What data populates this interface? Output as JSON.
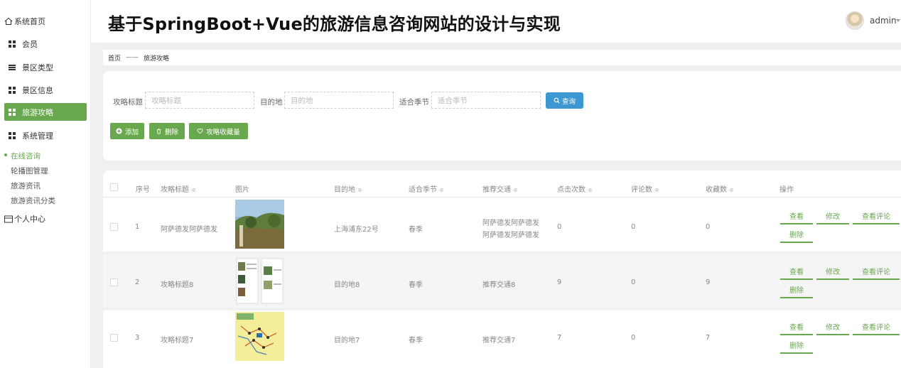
{
  "sidebar": {
    "home": "系统首页",
    "items": [
      {
        "label": "会员",
        "icon": "grid-icon"
      },
      {
        "label": "景区类型",
        "icon": "list-icon"
      },
      {
        "label": "景区信息",
        "icon": "grid-icon"
      },
      {
        "label": "旅游攻略",
        "icon": "grid-icon",
        "active": true
      },
      {
        "label": "系统管理",
        "icon": "grid-icon"
      }
    ],
    "sub_items": [
      "在线咨询",
      "轮播图管理",
      "旅游资讯",
      "旅游资讯分类"
    ],
    "personal": "个人中心"
  },
  "header": {
    "title": "基于SpringBoot+Vue的旅游信息咨询网站的设计与实现",
    "user": "admin"
  },
  "breadcrumb": {
    "home": "首页",
    "separator": "——",
    "current": "旅游攻略"
  },
  "search": {
    "fields": [
      {
        "label": "攻略标题",
        "placeholder": "攻略标题"
      },
      {
        "label": "目的地",
        "placeholder": "目的地"
      },
      {
        "label": "适合季节",
        "placeholder": "适合季节"
      }
    ],
    "query_button": "查询"
  },
  "toolbar": {
    "add": "添加",
    "delete": "删除",
    "favorites": "攻略收藏量"
  },
  "table": {
    "headers": [
      "序号",
      "攻略标题",
      "图片",
      "目的地",
      "适合季节",
      "推荐交通",
      "点击次数",
      "评论数",
      "收藏数",
      "操作"
    ],
    "rows": [
      {
        "index": "1",
        "title": "阿萨德发阿萨德发",
        "image": "mountain-photo",
        "destination": "上海浦东22号",
        "season": "春季",
        "transport_line1": "阿萨德发阿萨德发",
        "transport_line2": "阿萨德发阿萨德发",
        "clicks": "0",
        "comments": "0",
        "favorites": "0"
      },
      {
        "index": "2",
        "title": "攻略标题8",
        "image": "brochure-photo",
        "destination": "目的地8",
        "season": "春季",
        "transport_line1": "推荐交通8",
        "transport_line2": "",
        "clicks": "9",
        "comments": "0",
        "favorites": "9"
      },
      {
        "index": "3",
        "title": "攻略标题7",
        "image": "map-photo",
        "destination": "目的地7",
        "season": "春季",
        "transport_line1": "推荐交通7",
        "transport_line2": "",
        "clicks": "7",
        "comments": "0",
        "favorites": "7"
      }
    ],
    "actions": {
      "view": "查看",
      "edit": "修改",
      "view_comments": "查看评论",
      "delete": "删除"
    }
  },
  "colors": {
    "accent": "#6aa84f",
    "query": "#3d97d3"
  }
}
